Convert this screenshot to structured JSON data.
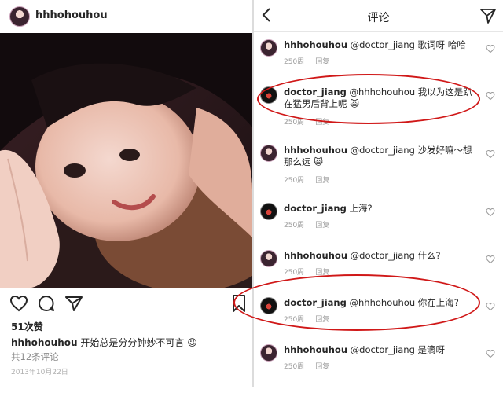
{
  "post": {
    "username": "hhhohouhou",
    "likes": "51次赞",
    "caption_user": "hhhohouhou",
    "caption_text": "开始总是分分钟妙不可言 😉",
    "view_comments": "共12条评论",
    "date": "2013年10月22日"
  },
  "comments_page": {
    "title": "评论",
    "items": [
      {
        "user": "hhhohouhou",
        "text": "@doctor_jiang 歌词呀 哈哈",
        "time": "250周",
        "reply": "回复",
        "avatar": "girl"
      },
      {
        "user": "doctor_jiang",
        "text": "@hhhohouhou 我以为这是趴在猛男后背上呢 🙀",
        "time": "250周",
        "reply": "回复",
        "avatar": "dj"
      },
      {
        "user": "hhhohouhou",
        "text": "@doctor_jiang 沙发好嘛～想那么远 🙀",
        "time": "250周",
        "reply": "回复",
        "avatar": "girl"
      },
      {
        "user": "doctor_jiang",
        "text": "上海?",
        "time": "250周",
        "reply": "回复",
        "avatar": "dj"
      },
      {
        "user": "hhhohouhou",
        "text": "@doctor_jiang 什么?",
        "time": "250周",
        "reply": "回复",
        "avatar": "girl"
      },
      {
        "user": "doctor_jiang",
        "text": "@hhhohouhou 你在上海?",
        "time": "250周",
        "reply": "回复",
        "avatar": "dj"
      },
      {
        "user": "hhhohouhou",
        "text": "@doctor_jiang 是滴呀",
        "time": "250周",
        "reply": "回复",
        "avatar": "girl"
      }
    ]
  },
  "colors": {
    "highlight_ring": "#d01818",
    "meta_gray": "#9a9a9a"
  },
  "icons": [
    "heart-icon",
    "comment-icon",
    "share-icon",
    "bookmark-icon",
    "back-icon",
    "send-icon",
    "small-heart-icon"
  ]
}
